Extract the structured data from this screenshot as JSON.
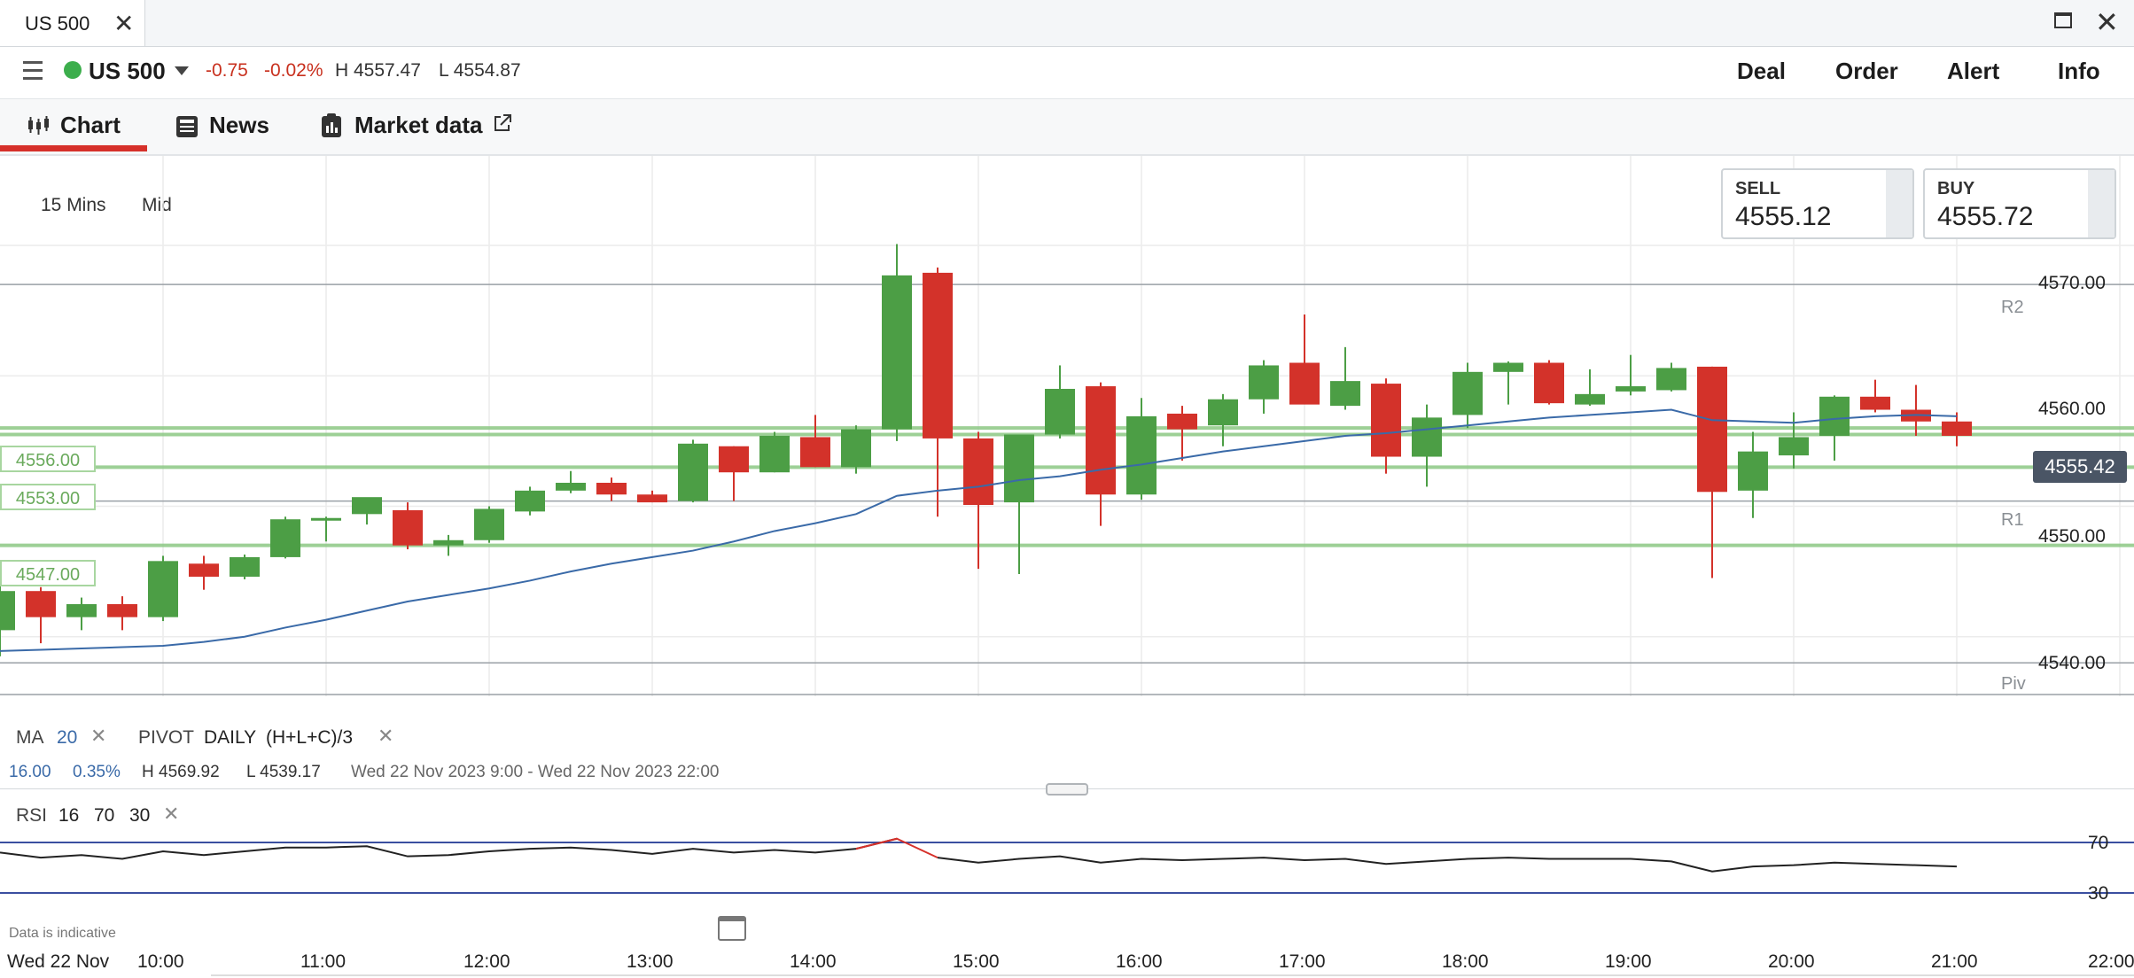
{
  "window": {
    "tab_title": "US 500",
    "close_glyph": "✕",
    "close_window_glyph": "✕"
  },
  "header": {
    "instrument": "US 500",
    "status_color": "#3cae4c",
    "change": "-0.75",
    "change_pct": "-0.02%",
    "high": "H 4557.47",
    "low": "L 4554.87",
    "nav": [
      "Deal",
      "Order",
      "Alert",
      "Info"
    ]
  },
  "subnav": {
    "chart": "Chart",
    "news": "News",
    "market_data": "Market data"
  },
  "options": {
    "interval": "15 Mins",
    "price_type": "Mid"
  },
  "prices": {
    "sell_label": "SELL",
    "sell": "4555.12",
    "buy_label": "BUY",
    "buy": "4555.72"
  },
  "current_price": "4555.42",
  "level_tags": [
    "4556.00",
    "4553.00",
    "4547.00"
  ],
  "pivots": {
    "r2": "R2",
    "r1": "R1",
    "piv": "Piv"
  },
  "y_ticks": [
    "4570.00",
    "4560.00",
    "4550.00",
    "4540.00"
  ],
  "indicators": {
    "ma_label": "MA",
    "ma_period": "20",
    "pivot_label": "PIVOT",
    "pivot_period": "DAILY",
    "pivot_formula": "(H+L+C)/3",
    "remove_glyph": "✕",
    "range": "16.00",
    "range_pct": "0.35%",
    "high": "H 4569.92",
    "low": "L 4539.17",
    "date_range": "Wed 22 Nov 2023 9:00 - Wed 22 Nov 2023 22:00"
  },
  "rsi": {
    "label": "RSI",
    "p1": "16",
    "p2": "70",
    "p3": "30",
    "upper": "70",
    "lower": "30"
  },
  "x_axis": {
    "date": "Wed 22 Nov",
    "times": [
      "10:00",
      "11:00",
      "12:00",
      "13:00",
      "14:00",
      "15:00",
      "16:00",
      "17:00",
      "18:00",
      "19:00",
      "20:00",
      "21:00",
      "22:00"
    ]
  },
  "footer": {
    "note": "Data is indicative"
  },
  "colors": {
    "up": "#4c9e45",
    "down": "#d3322a",
    "ma": "#3a6aa8",
    "level": "#8cc884",
    "rsi": "#222222",
    "rsi_band": "#3a4fa0"
  },
  "chart_data": {
    "type": "candlestick",
    "interval": "15 Mins",
    "y_range": [
      4535.5,
      4575.5
    ],
    "candles": [
      {
        "o": 4540.5,
        "h": 4544.5,
        "l": 4538.5,
        "c": 4543.5
      },
      {
        "o": 4543.5,
        "h": 4543.8,
        "l": 4539.5,
        "c": 4541.5
      },
      {
        "o": 4541.5,
        "h": 4543.0,
        "l": 4540.5,
        "c": 4542.5
      },
      {
        "o": 4542.5,
        "h": 4543.1,
        "l": 4540.5,
        "c": 4541.5
      },
      {
        "o": 4541.5,
        "h": 4546.2,
        "l": 4541.2,
        "c": 4545.8
      },
      {
        "o": 4545.6,
        "h": 4546.2,
        "l": 4543.6,
        "c": 4544.6
      },
      {
        "o": 4544.6,
        "h": 4546.3,
        "l": 4544.4,
        "c": 4546.1
      },
      {
        "o": 4546.1,
        "h": 4549.2,
        "l": 4546.0,
        "c": 4549.0
      },
      {
        "o": 4549.0,
        "h": 4549.2,
        "l": 4547.3,
        "c": 4549.1
      },
      {
        "o": 4549.4,
        "h": 4550.3,
        "l": 4548.6,
        "c": 4550.7
      },
      {
        "o": 4549.7,
        "h": 4550.3,
        "l": 4546.7,
        "c": 4547.0
      },
      {
        "o": 4547.0,
        "h": 4547.8,
        "l": 4546.2,
        "c": 4547.4
      },
      {
        "o": 4547.4,
        "h": 4550.0,
        "l": 4547.2,
        "c": 4549.8
      },
      {
        "o": 4549.6,
        "h": 4551.5,
        "l": 4549.3,
        "c": 4551.2
      },
      {
        "o": 4551.2,
        "h": 4552.7,
        "l": 4551.0,
        "c": 4551.8
      },
      {
        "o": 4551.8,
        "h": 4552.2,
        "l": 4550.4,
        "c": 4550.9
      },
      {
        "o": 4550.9,
        "h": 4551.2,
        "l": 4550.3,
        "c": 4550.3
      },
      {
        "o": 4550.4,
        "h": 4555.1,
        "l": 4550.3,
        "c": 4554.8
      },
      {
        "o": 4554.6,
        "h": 4554.6,
        "l": 4550.4,
        "c": 4552.6
      },
      {
        "o": 4552.6,
        "h": 4555.7,
        "l": 4552.6,
        "c": 4555.4
      },
      {
        "o": 4555.3,
        "h": 4557.0,
        "l": 4553.0,
        "c": 4553.0
      },
      {
        "o": 4553.0,
        "h": 4556.2,
        "l": 4552.5,
        "c": 4555.9
      },
      {
        "o": 4555.9,
        "h": 4570.1,
        "l": 4555.0,
        "c": 4567.7
      },
      {
        "o": 4567.9,
        "h": 4568.3,
        "l": 4549.2,
        "c": 4555.2
      },
      {
        "o": 4555.2,
        "h": 4555.7,
        "l": 4545.2,
        "c": 4550.1
      },
      {
        "o": 4550.3,
        "h": 4555.5,
        "l": 4544.8,
        "c": 4555.5
      },
      {
        "o": 4555.5,
        "h": 4560.8,
        "l": 4555.2,
        "c": 4559.0
      },
      {
        "o": 4559.2,
        "h": 4559.5,
        "l": 4548.5,
        "c": 4550.9
      },
      {
        "o": 4550.9,
        "h": 4558.3,
        "l": 4550.5,
        "c": 4556.9
      },
      {
        "o": 4557.1,
        "h": 4557.7,
        "l": 4553.5,
        "c": 4555.9
      },
      {
        "o": 4556.2,
        "h": 4558.6,
        "l": 4554.6,
        "c": 4558.2
      },
      {
        "o": 4558.2,
        "h": 4561.2,
        "l": 4557.1,
        "c": 4560.8
      },
      {
        "o": 4561.0,
        "h": 4564.7,
        "l": 4558.0,
        "c": 4557.8
      },
      {
        "o": 4557.7,
        "h": 4562.2,
        "l": 4557.4,
        "c": 4559.6
      },
      {
        "o": 4559.4,
        "h": 4559.8,
        "l": 4552.5,
        "c": 4553.8
      },
      {
        "o": 4553.8,
        "h": 4557.8,
        "l": 4551.5,
        "c": 4556.8
      },
      {
        "o": 4557.0,
        "h": 4561.0,
        "l": 4556.0,
        "c": 4560.3
      },
      {
        "o": 4560.3,
        "h": 4561.1,
        "l": 4557.8,
        "c": 4561.0
      },
      {
        "o": 4561.0,
        "h": 4561.2,
        "l": 4557.8,
        "c": 4557.9
      },
      {
        "o": 4557.8,
        "h": 4560.5,
        "l": 4557.7,
        "c": 4558.6
      },
      {
        "o": 4558.8,
        "h": 4561.6,
        "l": 4558.5,
        "c": 4559.2
      },
      {
        "o": 4558.9,
        "h": 4561.0,
        "l": 4558.8,
        "c": 4560.6
      },
      {
        "o": 4560.7,
        "h": 4560.7,
        "l": 4544.5,
        "c": 4551.1
      },
      {
        "o": 4551.2,
        "h": 4555.7,
        "l": 4549.1,
        "c": 4554.2
      },
      {
        "o": 4553.9,
        "h": 4557.2,
        "l": 4552.9,
        "c": 4555.3
      },
      {
        "o": 4555.4,
        "h": 4558.5,
        "l": 4553.5,
        "c": 4558.4
      },
      {
        "o": 4558.4,
        "h": 4559.7,
        "l": 4557.2,
        "c": 4557.4
      },
      {
        "o": 4557.4,
        "h": 4559.3,
        "l": 4555.4,
        "c": 4556.5
      },
      {
        "o": 4556.5,
        "h": 4557.2,
        "l": 4554.6,
        "c": 4555.4
      }
    ],
    "ma20": [
      4538.9,
      4539.0,
      4539.1,
      4539.2,
      4539.3,
      4539.6,
      4540.0,
      4540.7,
      4541.3,
      4542.0,
      4542.7,
      4543.2,
      4543.7,
      4544.3,
      4545.0,
      4545.6,
      4546.1,
      4546.6,
      4547.3,
      4548.1,
      4548.7,
      4549.4,
      4550.8,
      4551.2,
      4551.5,
      4552.0,
      4552.3,
      4552.8,
      4553.2,
      4553.7,
      4554.2,
      4554.6,
      4555.0,
      4555.4,
      4555.6,
      4555.9,
      4556.2,
      4556.5,
      4556.8,
      4557.0,
      4557.2,
      4557.4,
      4556.6,
      4556.5,
      4556.4,
      4556.7,
      4556.9,
      4557.0,
      4556.9
    ],
    "pivot_levels": {
      "R2": 4567.0,
      "R1": 4550.4,
      "Piv": 4538.0
    },
    "horizontal_levels": [
      4556.0,
      4555.5,
      4553.0,
      4547.0
    ],
    "rsi_range": [
      0,
      100
    ],
    "rsi": [
      62,
      58,
      60,
      57,
      63,
      60,
      63,
      66,
      66,
      67,
      59,
      60,
      63,
      65,
      66,
      64,
      61,
      65,
      62,
      64,
      62,
      65,
      73,
      58,
      54,
      57,
      59,
      54,
      57,
      56,
      57,
      58,
      56,
      57,
      53,
      55,
      57,
      58,
      57,
      57,
      57,
      55,
      47,
      51,
      52,
      54,
      53,
      52,
      51
    ]
  }
}
